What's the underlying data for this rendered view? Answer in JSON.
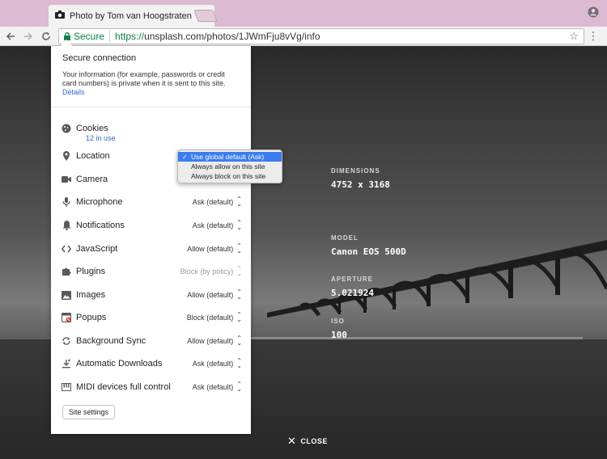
{
  "browser": {
    "tab_title": "Photo by Tom van Hoogstraten",
    "tab_close": "×",
    "secure_label": "Secure",
    "url_scheme": "https://",
    "url_rest": "unsplash.com/photos/1JWmFju8vVg/info"
  },
  "popup": {
    "title": "Secure connection",
    "description": "Your information (for example, passwords or credit card numbers) is private when it is sent to this site.",
    "details_link": "Details",
    "cookies": {
      "label": "Cookies",
      "sub": "12 in use"
    },
    "permissions": [
      {
        "label": "Location",
        "value": ""
      },
      {
        "label": "Camera",
        "value": ""
      },
      {
        "label": "Microphone",
        "value": "Ask (default)"
      },
      {
        "label": "Notifications",
        "value": "Ask (default)"
      },
      {
        "label": "JavaScript",
        "value": "Allow (default)"
      },
      {
        "label": "Plugins",
        "value": "Block (by policy)"
      },
      {
        "label": "Images",
        "value": "Allow (default)"
      },
      {
        "label": "Popups",
        "value": "Block (default)"
      },
      {
        "label": "Background Sync",
        "value": "Allow (default)"
      },
      {
        "label": "Automatic Downloads",
        "value": "Ask (default)"
      },
      {
        "label": "MIDI devices full control",
        "value": "Ask (default)"
      }
    ],
    "site_settings_button": "Site settings"
  },
  "dropdown": {
    "options": [
      "Use global default (Ask)",
      "Always allow on this site",
      "Always block on this site"
    ],
    "selected_index": 0
  },
  "photo_info": {
    "dimensions_label": "DIMENSIONS",
    "dimensions_value": "4752 x 3168",
    "model_label": "MODEL",
    "model_value": "Canon EOS 500D",
    "aperture_label": "APERTURE",
    "aperture_value": "5.021924",
    "iso_label": "ISO",
    "iso_value": "100",
    "close_label": "CLOSE"
  },
  "colors": {
    "tabstrip": "#dcbad1",
    "secure_green": "#0b8043",
    "link_blue": "#3367d6",
    "dropdown_selected": "#3b7cf2"
  }
}
